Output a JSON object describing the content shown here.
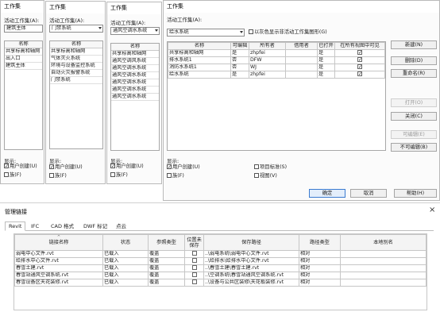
{
  "dlg1": {
    "title": "工作集",
    "active_label": "活动工作集(A):",
    "active_value": "建筑主体",
    "col_header": "名称",
    "items": [
      "共享标高和轴网",
      "出入口",
      "建筑主体"
    ],
    "show_label": "显示:",
    "chk_user": "用户创建(U)",
    "chk_user_mark": "✓",
    "chk_other": "族(F)"
  },
  "dlg2": {
    "title": "工作集",
    "active_label": "活动工作集(A):",
    "active_value": "门禁系统",
    "col_header": "名称",
    "items": [
      "共享标高和轴网",
      "气体灭火系统",
      "环境与设备监控系统",
      "自动火灾报警系统",
      "门禁系统"
    ],
    "show_label": "显示:",
    "chk_user": "用户创建(U)",
    "chk_user_mark": "✓",
    "chk_other": "族(F)"
  },
  "dlg3": {
    "title": "工作集",
    "active_label": "活动工作集(A):",
    "active_value": "通风空调水系统",
    "col_header": "名称",
    "items": [
      "共享标高和轴网",
      "通风空调风系统",
      "通风空调水系统",
      "通风空调水系统",
      "通风空调水系统",
      "通风空调水系统",
      "通风空调水系统"
    ],
    "show_label": "显示:",
    "chk_user": "用户创建(U)",
    "chk_user_mark": "✓",
    "chk_other": "族(F)"
  },
  "dlg4": {
    "title": "工作集",
    "active_label": "活动工作集(A):",
    "active_value": "给水系统",
    "gray_chk": "以灰色显示非活动工作集图形(G)",
    "columns": [
      "名称",
      "可编辑",
      "所有者",
      "借用者",
      "已打开",
      "在所有视图中可见"
    ],
    "rows": [
      {
        "name": "共享标高和轴网",
        "editable": "是",
        "owner": "zhpfei",
        "borrower": "",
        "opened": "是",
        "visible": "✓"
      },
      {
        "name": "排水系统1",
        "editable": "否",
        "owner": "DFW",
        "borrower": "",
        "opened": "是",
        "visible": "✓"
      },
      {
        "name": "消防水系统1",
        "editable": "否",
        "owner": "WJ",
        "borrower": "",
        "opened": "是",
        "visible": "✓"
      },
      {
        "name": "给水系统",
        "editable": "是",
        "owner": "zhpfei",
        "borrower": "",
        "opened": "是",
        "visible": "✓"
      }
    ],
    "buttons": {
      "new": "新建(N)",
      "delete": "删除(D)",
      "rename": "重命名(R)",
      "open": "打开(O)",
      "close": "关闭(C)",
      "editable": "可编辑(E)",
      "not_editable": "不可编辑(B)"
    },
    "show_label": "显示:",
    "chk_user": "用户创建(U)",
    "chk_user_mark": "✓",
    "chk_family": "族(F)",
    "chk_project": "项目标准(S)",
    "chk_view": "视图(V)",
    "ok": "确定",
    "cancel": "取消",
    "help": "帮助(H)"
  },
  "links": {
    "title": "管理链接",
    "close": "×",
    "tabs": [
      "Revit",
      "IFC",
      "CAD 格式",
      "DWF 标记",
      "点云"
    ],
    "columns": [
      "链接名称",
      "状态",
      "参照类型",
      "位置未保存",
      "保存路径",
      "路径类型",
      "本地别名"
    ],
    "rows": [
      {
        "name": "弱电中心文件.rvt",
        "status": "已载入",
        "ref": "覆盖",
        "path": "..\\弱电系统\\弱电中心文件.rvt",
        "ptype": "相对",
        "alias": ""
      },
      {
        "name": "给排水中心文件.rvt",
        "status": "已载入",
        "ref": "覆盖",
        "path": "..\\给排水\\给排水中心文件.rvt",
        "ptype": "相对",
        "alias": ""
      },
      {
        "name": "春雪土建.rvt",
        "status": "已载入",
        "ref": "覆盖",
        "path": "..\\春雪土建\\春雪土建.rvt",
        "ptype": "相对",
        "alias": ""
      },
      {
        "name": "春雪站通风空调系统.rvt",
        "status": "已载入",
        "ref": "覆盖",
        "path": "..\\空调系统\\春雪站通风空调系统.rvt",
        "ptype": "相对",
        "alias": ""
      },
      {
        "name": "春雪设备区天花装修.rvt",
        "status": "已载入",
        "ref": "覆盖",
        "path": "..\\设备与公共区装修\\天花板装修.rvt",
        "ptype": "相对",
        "alias": ""
      }
    ]
  }
}
